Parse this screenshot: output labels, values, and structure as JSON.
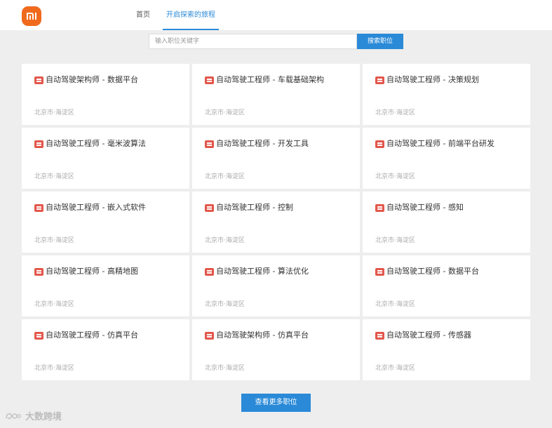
{
  "header": {
    "logo_text": "mi",
    "nav": [
      {
        "label": "首页"
      },
      {
        "label": "开启探索的旅程"
      }
    ]
  },
  "search": {
    "placeholder": "输入职位关键字",
    "value": "",
    "button_label": "搜索职位"
  },
  "jobs": [
    {
      "title": "自动驾驶架构师 - 数据平台",
      "location": "北京市·海淀区"
    },
    {
      "title": "自动驾驶工程师 - 车载基础架构",
      "location": "北京市·海淀区"
    },
    {
      "title": "自动驾驶工程师 - 决策规划",
      "location": "北京市·海淀区"
    },
    {
      "title": "自动驾驶工程师 - 毫米波算法",
      "location": "北京市·海淀区"
    },
    {
      "title": "自动驾驶工程师 - 开发工具",
      "location": "北京市·海淀区"
    },
    {
      "title": "自动驾驶工程师 - 前端平台研发",
      "location": "北京市·海淀区"
    },
    {
      "title": "自动驾驶工程师 - 嵌入式软件",
      "location": "北京市·海淀区"
    },
    {
      "title": "自动驾驶工程师 - 控制",
      "location": "北京市·海淀区"
    },
    {
      "title": "自动驾驶工程师 - 感知",
      "location": "北京市·海淀区"
    },
    {
      "title": "自动驾驶工程师 - 高精地图",
      "location": "北京市·海淀区"
    },
    {
      "title": "自动驾驶工程师 - 算法优化",
      "location": "北京市·海淀区"
    },
    {
      "title": "自动驾驶工程师 - 数据平台",
      "location": "北京市·海淀区"
    },
    {
      "title": "自动驾驶工程师 - 仿真平台",
      "location": "北京市·海淀区"
    },
    {
      "title": "自动驾驶架构师 - 仿真平台",
      "location": "北京市·海淀区"
    },
    {
      "title": "自动驾驶工程师 - 传感器",
      "location": "北京市·海淀区"
    }
  ],
  "more_button_label": "查看更多职位",
  "watermark": {
    "text": "大数跨境"
  },
  "colors": {
    "accent": "#2a8ad8",
    "logo": "#f06a1e",
    "job_icon": "#e2574c",
    "background": "#eeeeee"
  },
  "icons": {
    "logo": "xiaomi-logo",
    "job": "job-document-icon",
    "watermark": "watermark-logo-icon"
  }
}
